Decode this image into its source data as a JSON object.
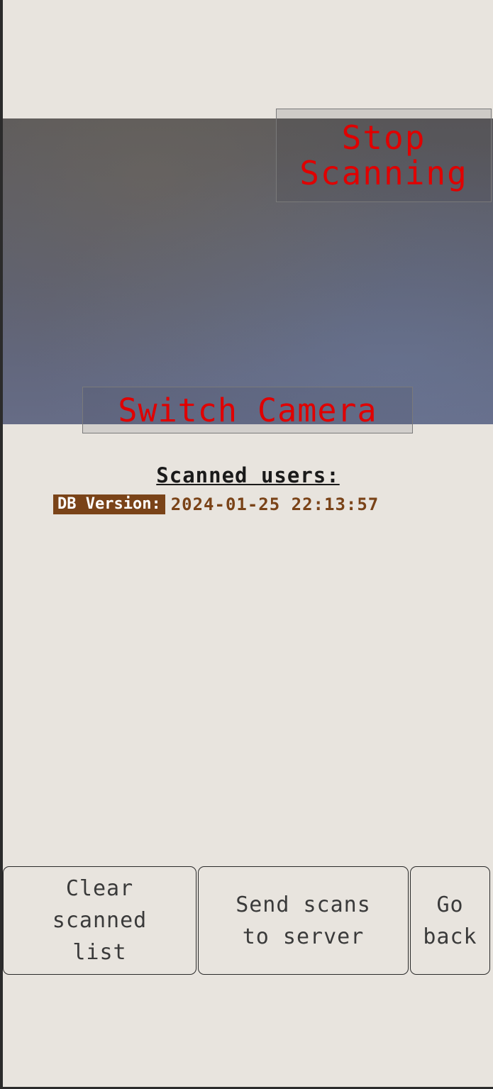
{
  "camera": {
    "stop_label": "Stop\nScanning",
    "switch_label": "Switch Camera"
  },
  "scanned": {
    "title": "Scanned users:",
    "db_label": "DB Version:",
    "db_value": "2024-01-25 22:13:57"
  },
  "actions": {
    "clear_label": "Clear\nscanned\nlist",
    "send_label": "Send scans\nto server",
    "back_label": "Go\nback"
  },
  "colors": {
    "accent_red": "#e00000",
    "db_brown": "#7a4318",
    "background": "#e8e4de"
  }
}
